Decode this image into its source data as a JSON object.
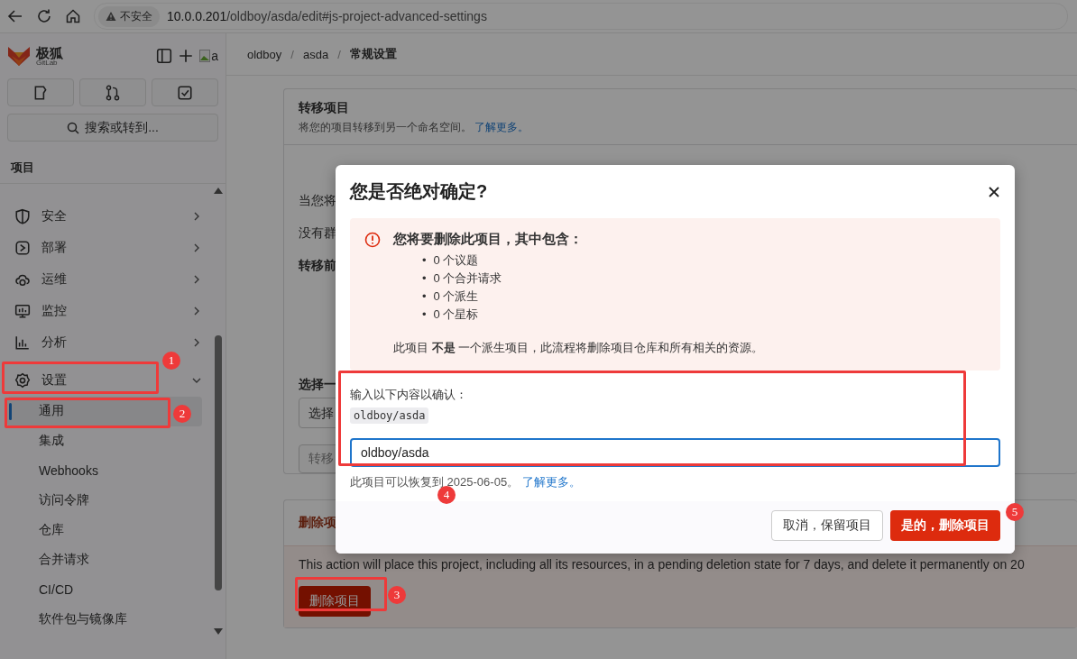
{
  "browser": {
    "security": "不安全",
    "url_host": "10.0.0.201",
    "url_path": "/oldboy/asda/edit#js-project-advanced-settings"
  },
  "sidebar": {
    "brand": "极狐",
    "brand_sub": "GitLab",
    "avatar_alt": "a",
    "search": "搜索或转到...",
    "section": "项目",
    "items": [
      {
        "label": "安全",
        "expanded": false
      },
      {
        "label": "部署",
        "expanded": false
      },
      {
        "label": "运维",
        "expanded": false
      },
      {
        "label": "监控",
        "expanded": false
      },
      {
        "label": "分析",
        "expanded": false
      },
      {
        "label": "设置",
        "expanded": true,
        "children": [
          {
            "label": "通用",
            "selected": true
          },
          {
            "label": "集成",
            "selected": false
          },
          {
            "label": "Webhooks",
            "selected": false
          },
          {
            "label": "访问令牌",
            "selected": false
          },
          {
            "label": "仓库",
            "selected": false
          },
          {
            "label": "合并请求",
            "selected": false
          },
          {
            "label": "CI/CD",
            "selected": false
          },
          {
            "label": "软件包与镜像库",
            "selected": false
          }
        ]
      }
    ]
  },
  "breadcrumb": [
    "oldboy",
    "asda",
    "常规设置"
  ],
  "breadcrumb_separator": "/",
  "transfer_card": {
    "title": "转移项目",
    "description": "将您的项目转移到另一个命名空间。",
    "link": "了解更多。",
    "lines": [
      {
        "kind": "text",
        "text": "当您将"
      },
      {
        "kind": "text",
        "text": "没有群"
      },
      {
        "kind": "heading",
        "text": "转移前"
      },
      {
        "kind": "heading",
        "text": "选择一"
      },
      {
        "kind": "select",
        "text": "选择"
      },
      {
        "kind": "button",
        "text": "转移"
      }
    ]
  },
  "delete_card": {
    "title": "删除项",
    "body": "This action will place this project, including all its resources, in a pending deletion state for 7 days, and delete it permanently on 20",
    "button": "删除项目"
  },
  "modal": {
    "title": "您是否绝对确定?",
    "alert": {
      "bullet": "•",
      "heading": "您将要删除此项目，其中包含：",
      "items": [
        "0 个议题",
        "0 个合并请求",
        "0 个派生",
        "0 个星标"
      ],
      "note": "此项目 **不是** 一个派生项目，此流程将删除项目仓库和所有相关的资源。"
    },
    "confirm_label": "输入以下内容以确认：",
    "confirm_code": "oldboy/asda",
    "input_value": "oldboy/asda",
    "help": "此项目可以恢复到 2025-06-05。",
    "help_link": "了解更多。",
    "cancel": "取消，保留项目",
    "confirm": "是的，删除项目"
  },
  "annotations": [
    "1",
    "2",
    "3",
    "4",
    "5"
  ]
}
